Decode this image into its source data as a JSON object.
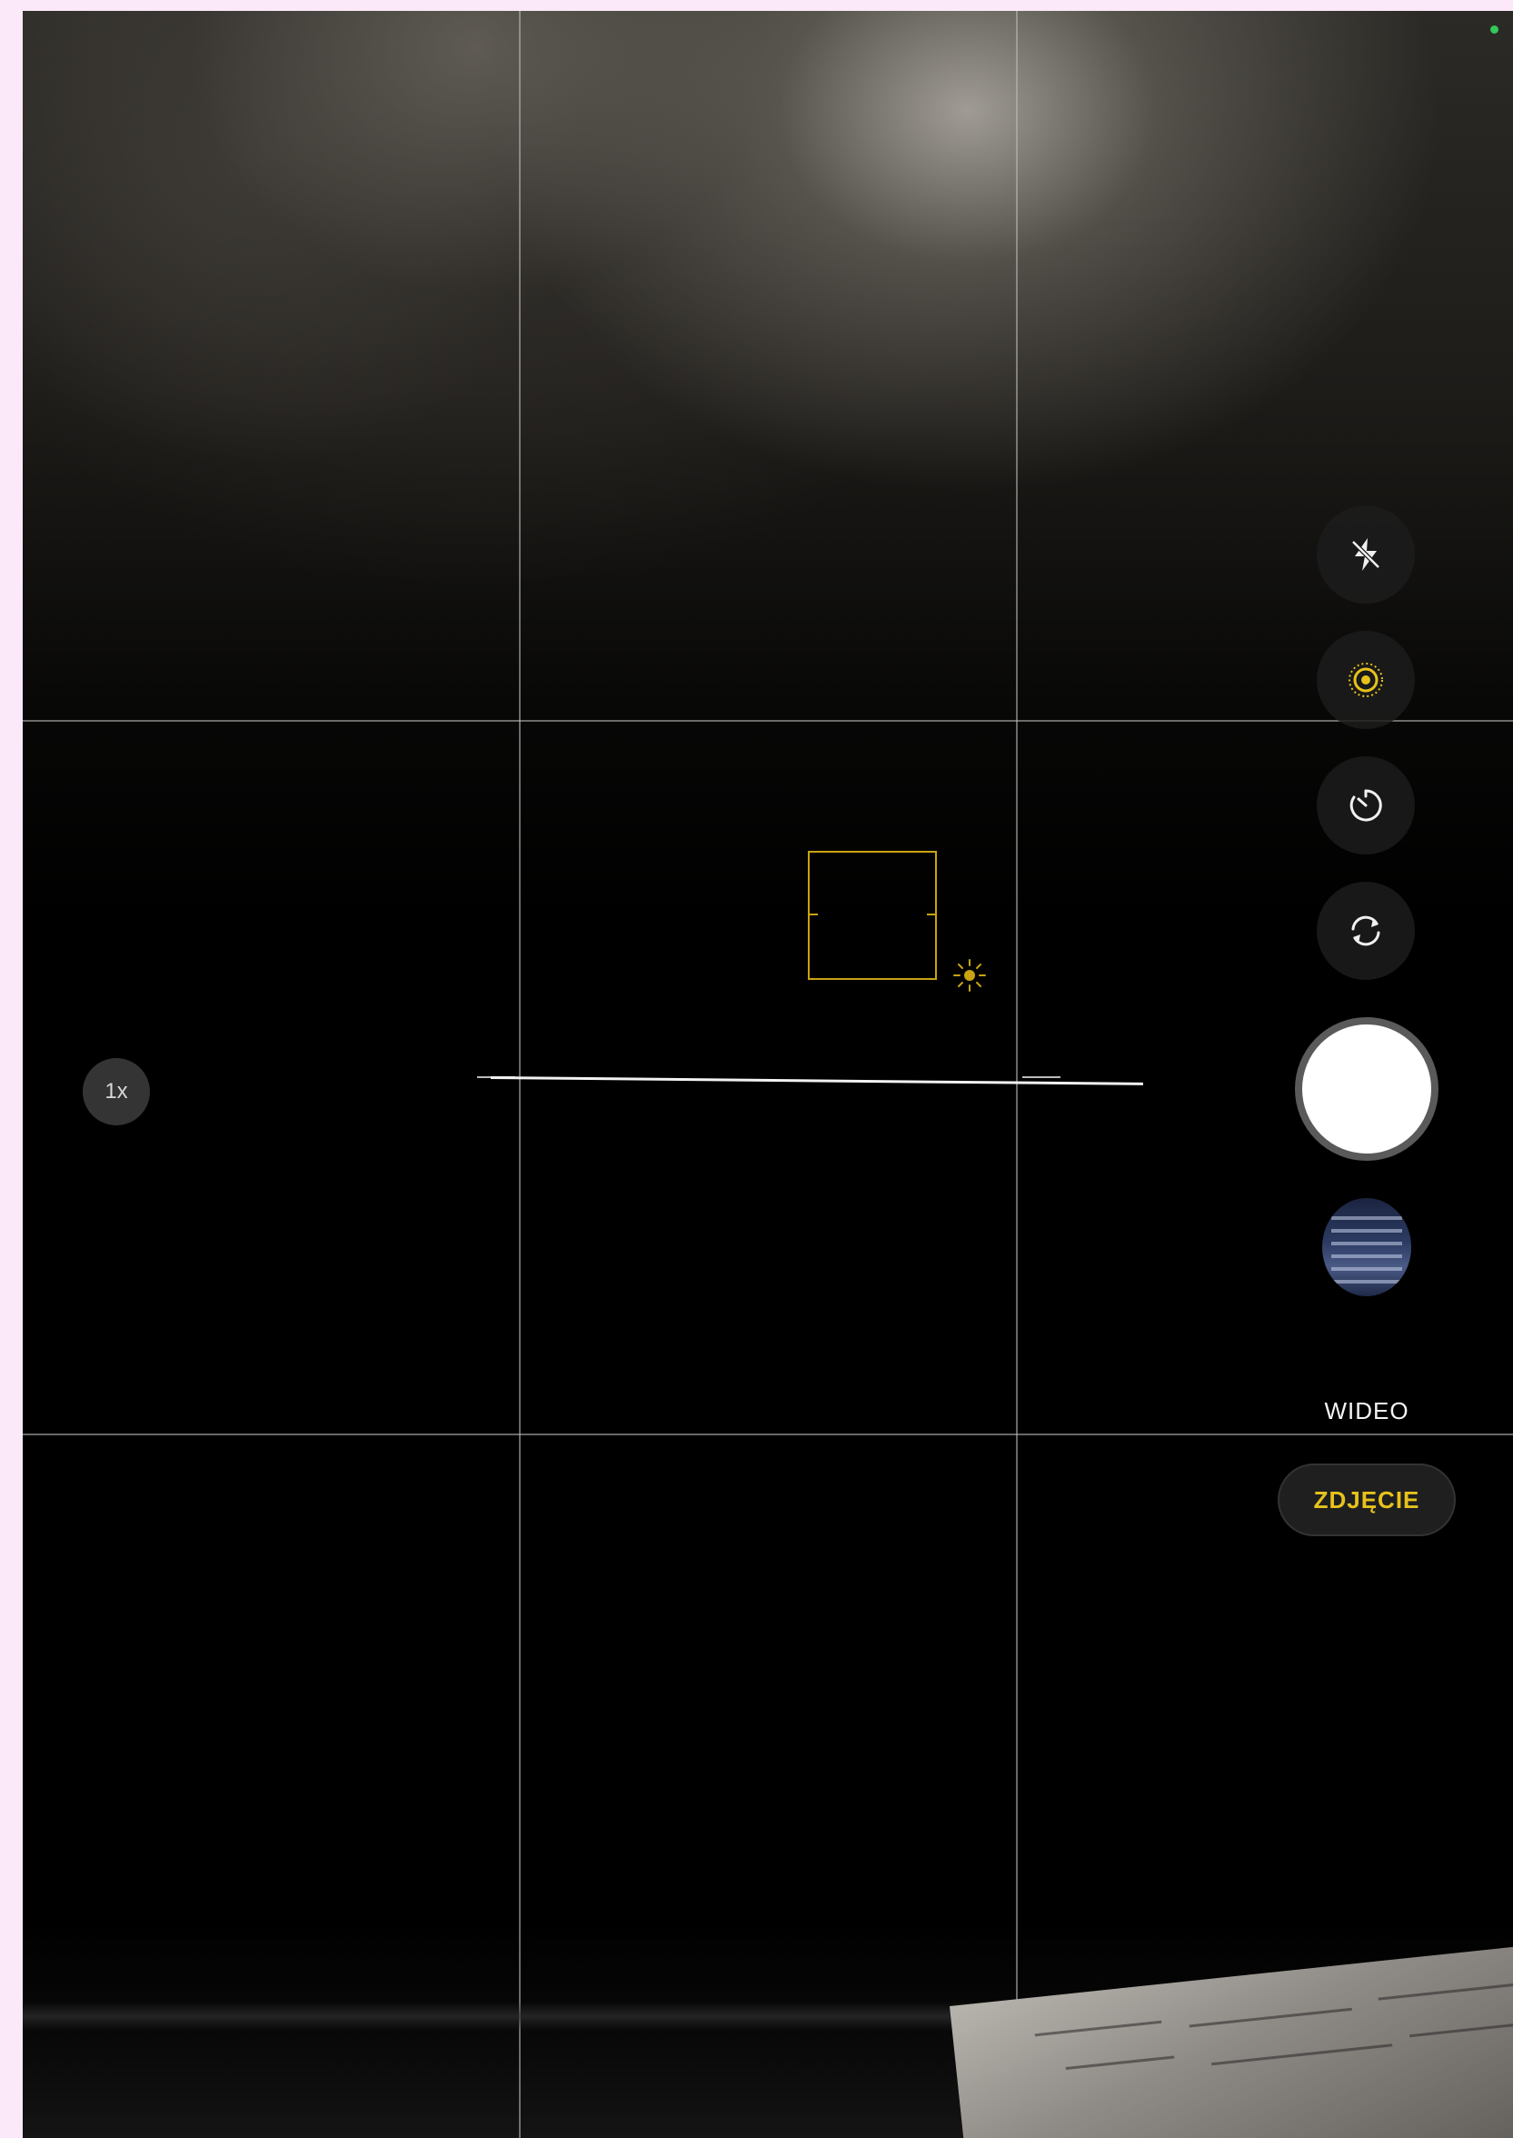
{
  "camera": {
    "zoom_label": "1x",
    "modes": {
      "video_label": "WIDEO",
      "photo_label": "ZDJĘCIE",
      "active_mode": "photo"
    },
    "controls": {
      "flash": {
        "icon": "flash-off-icon",
        "state": "off"
      },
      "live_photo": {
        "icon": "live-photo-icon",
        "state": "on",
        "color": "#e7c21c"
      },
      "timer": {
        "icon": "timer-icon"
      },
      "switch_camera": {
        "icon": "switch-camera-icon"
      }
    },
    "focus": {
      "color": "#c9a312",
      "exposure_icon": "sun-icon"
    },
    "grid": {
      "visible": true,
      "columns": 3,
      "rows": 3
    },
    "level_indicator": {
      "visible": true
    },
    "indicator": {
      "icon": "camera-in-use-dot",
      "color": "#34c759"
    }
  }
}
